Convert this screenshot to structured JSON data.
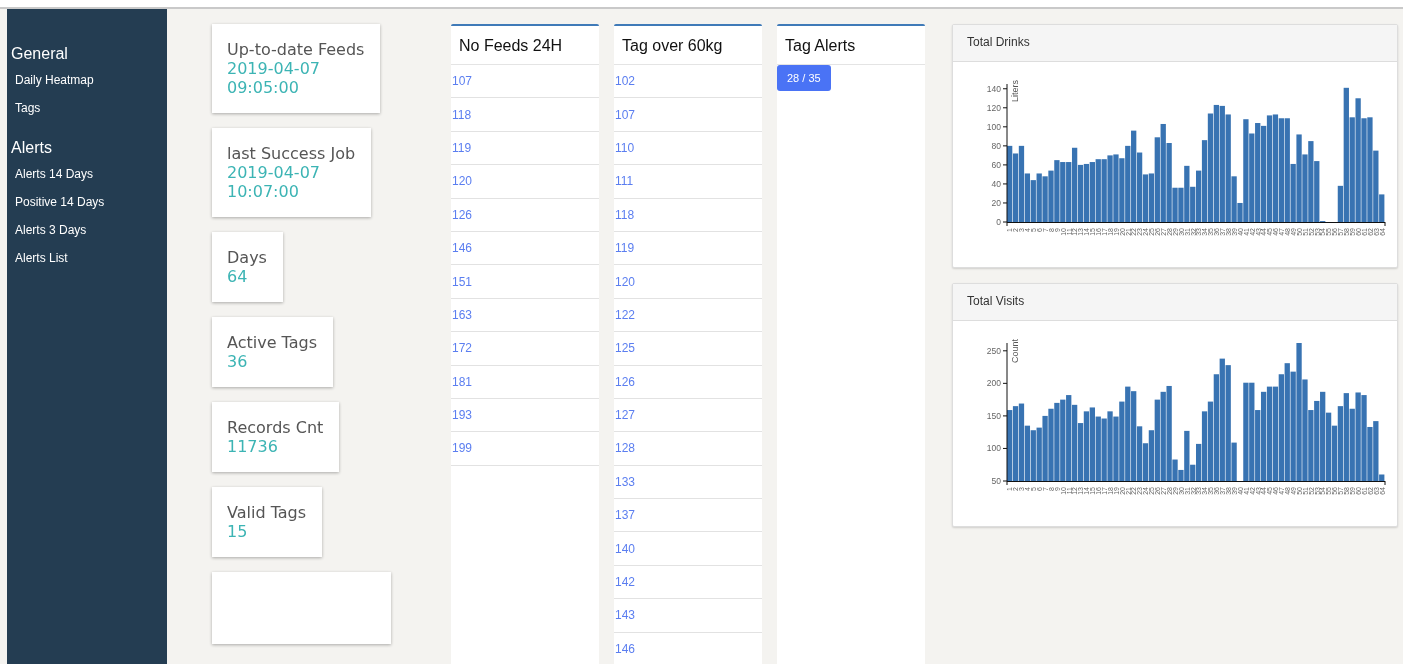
{
  "sidebar": {
    "sections": [
      {
        "title": "General",
        "items": [
          {
            "label": "Daily Heatmap"
          },
          {
            "label": "Tags"
          }
        ]
      },
      {
        "title": "Alerts",
        "items": [
          {
            "label": "Alerts 14 Days"
          },
          {
            "label": "Positive 14 Days"
          },
          {
            "label": "Alerts 3 Days"
          },
          {
            "label": "Alerts List"
          }
        ]
      }
    ]
  },
  "stat_cards": [
    {
      "label": "Up-to-date Feeds",
      "value": "2019-04-07 09:05:00"
    },
    {
      "label": "last Success Job",
      "value": "2019-04-07 10:07:00"
    },
    {
      "label": "Days",
      "value": "64"
    },
    {
      "label": "Active Tags",
      "value": "36"
    },
    {
      "label": "Records Cnt",
      "value": "11736"
    },
    {
      "label": "Valid Tags",
      "value": "15"
    },
    {
      "kind": "empty"
    }
  ],
  "lists": [
    {
      "title": "No Feeds 24H",
      "items": [
        "107",
        "118",
        "119",
        "120",
        "126",
        "146",
        "151",
        "163",
        "172",
        "181",
        "193",
        "199"
      ]
    },
    {
      "title": "Tag over 60kg",
      "items": [
        "102",
        "107",
        "110",
        "111",
        "118",
        "119",
        "120",
        "122",
        "125",
        "126",
        "127",
        "128",
        "133",
        "137",
        "140",
        "142",
        "143",
        "146"
      ]
    },
    {
      "title": "Tag Alerts",
      "badge": "28 / 35"
    }
  ],
  "charts": [
    {
      "title": "Total Drinks",
      "chart_data": {
        "type": "bar",
        "ylabel": "Liters",
        "categories": [
          "1",
          "2",
          "3",
          "4",
          "5",
          "6",
          "7",
          "8",
          "9",
          "10",
          "11",
          "12",
          "13",
          "14",
          "15",
          "16",
          "17",
          "18",
          "19",
          "20",
          "21",
          "22",
          "23",
          "24",
          "25",
          "26",
          "27",
          "28",
          "29",
          "30",
          "31",
          "32",
          "33",
          "34",
          "35",
          "36",
          "37",
          "38",
          "39",
          "40",
          "41",
          "42",
          "43",
          "44",
          "45",
          "46",
          "47",
          "48",
          "49",
          "50",
          "51",
          "52",
          "53",
          "54",
          "55",
          "56",
          "57",
          "58",
          "59",
          "60",
          "61",
          "62",
          "63",
          "64"
        ],
        "values": [
          80,
          72,
          80,
          51,
          44,
          51,
          48,
          54,
          65,
          63,
          63,
          78,
          60,
          61,
          63,
          66,
          66,
          70,
          71,
          67,
          80,
          96,
          73,
          50,
          51,
          89,
          103,
          83,
          36,
          36,
          59,
          37,
          54,
          86,
          114,
          123,
          122,
          113,
          48,
          20,
          108,
          93,
          104,
          101,
          112,
          113,
          109,
          109,
          61,
          92,
          71,
          85,
          64,
          1,
          0,
          0,
          38,
          141,
          110,
          130,
          109,
          110,
          75,
          29
        ],
        "ylim": [
          0,
          145
        ],
        "yticks": [
          0,
          20,
          40,
          60,
          80,
          100,
          120,
          140
        ]
      }
    },
    {
      "title": "Total Visits",
      "chart_data": {
        "type": "bar",
        "ylabel": "Count",
        "categories": [
          "1",
          "2",
          "3",
          "4",
          "5",
          "6",
          "7",
          "8",
          "9",
          "10",
          "11",
          "12",
          "13",
          "14",
          "15",
          "16",
          "17",
          "18",
          "19",
          "20",
          "21",
          "22",
          "23",
          "24",
          "25",
          "26",
          "27",
          "28",
          "29",
          "30",
          "31",
          "32",
          "33",
          "34",
          "35",
          "36",
          "37",
          "38",
          "39",
          "40",
          "41",
          "42",
          "43",
          "44",
          "45",
          "46",
          "47",
          "48",
          "49",
          "50",
          "51",
          "52",
          "53",
          "54",
          "55",
          "56",
          "57",
          "58",
          "59",
          "60",
          "61",
          "62",
          "63",
          "64"
        ],
        "values": [
          159,
          165,
          169,
          135,
          128,
          132,
          150,
          161,
          170,
          175,
          182,
          167,
          139,
          157,
          163,
          149,
          146,
          157,
          149,
          172,
          195,
          188,
          134,
          108,
          128,
          175,
          187,
          196,
          83,
          67,
          127,
          75,
          107,
          157,
          172,
          214,
          238,
          228,
          109,
          null,
          201,
          201,
          159,
          187,
          195,
          195,
          214,
          231,
          218,
          262,
          206,
          159,
          173,
          187,
          155,
          135,
          165,
          185,
          161,
          186,
          182,
          133,
          142,
          60
        ],
        "ylim": [
          50,
          262
        ],
        "yticks": [
          50,
          100,
          150,
          200,
          250
        ]
      }
    }
  ]
}
